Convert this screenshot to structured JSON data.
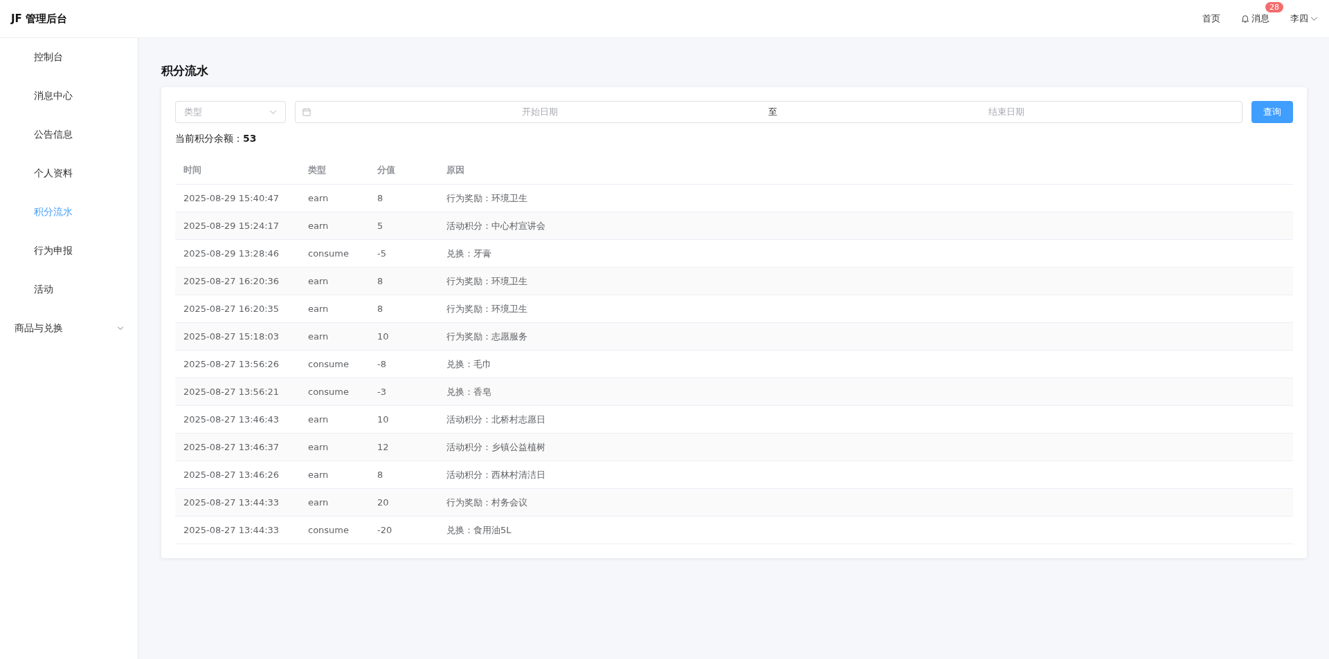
{
  "header": {
    "logo": "JF 管理后台",
    "links": [
      {
        "kind": "link",
        "label": "首页"
      },
      {
        "kind": "bell",
        "label": "消息",
        "badge": "28"
      },
      {
        "kind": "user",
        "label": "李四"
      }
    ]
  },
  "sidebar": {
    "items": [
      {
        "label": "控制台",
        "selected": false
      },
      {
        "label": "消息中心",
        "selected": false
      },
      {
        "label": "公告信息",
        "selected": false
      },
      {
        "label": "个人资料",
        "selected": false
      },
      {
        "label": "积分流水",
        "selected": true
      },
      {
        "label": "行为申报",
        "selected": false
      },
      {
        "label": "活动",
        "selected": false
      },
      {
        "label": "商品与兑换",
        "selected": false,
        "expanded": false
      }
    ]
  },
  "page": {
    "title": "积分流水",
    "filters": {
      "type_placeholder": "类型",
      "start_placeholder": "开始日期",
      "separator": "至",
      "end_placeholder": "结束日期",
      "button": "查询"
    },
    "balance": {
      "label": "当前积分余额：",
      "value": "53"
    },
    "table": {
      "columns": [
        "时间",
        "类型",
        "分值",
        "原因"
      ],
      "rows": [
        {
          "cells": [
            "2025-08-29 15:40:47",
            "earn",
            "8",
            "行为奖励：环境卫生"
          ]
        },
        {
          "cells": [
            "2025-08-29 15:24:17",
            "earn",
            "5",
            "活动积分：中心村宣讲会"
          ]
        },
        {
          "cells": [
            "2025-08-29 13:28:46",
            "consume",
            "-5",
            "兑换：牙膏"
          ]
        },
        {
          "cells": [
            "2025-08-27 16:20:36",
            "earn",
            "8",
            "行为奖励：环境卫生"
          ]
        },
        {
          "cells": [
            "2025-08-27 16:20:35",
            "earn",
            "8",
            "行为奖励：环境卫生"
          ]
        },
        {
          "cells": [
            "2025-08-27 15:18:03",
            "earn",
            "10",
            "行为奖励：志愿服务"
          ]
        },
        {
          "cells": [
            "2025-08-27 13:56:26",
            "consume",
            "-8",
            "兑换：毛巾"
          ]
        },
        {
          "cells": [
            "2025-08-27 13:56:21",
            "consume",
            "-3",
            "兑换：香皂"
          ]
        },
        {
          "cells": [
            "2025-08-27 13:46:43",
            "earn",
            "10",
            "活动积分：北桥村志愿日"
          ]
        },
        {
          "cells": [
            "2025-08-27 13:46:37",
            "earn",
            "12",
            "活动积分：乡镇公益植树"
          ]
        },
        {
          "cells": [
            "2025-08-27 13:46:26",
            "earn",
            "8",
            "活动积分：西林村清洁日"
          ]
        },
        {
          "cells": [
            "2025-08-27 13:44:33",
            "earn",
            "20",
            "行为奖励：村务会议"
          ]
        },
        {
          "cells": [
            "2025-08-27 13:44:33",
            "consume",
            "-20",
            "兑换：食用油5L"
          ]
        }
      ]
    }
  }
}
